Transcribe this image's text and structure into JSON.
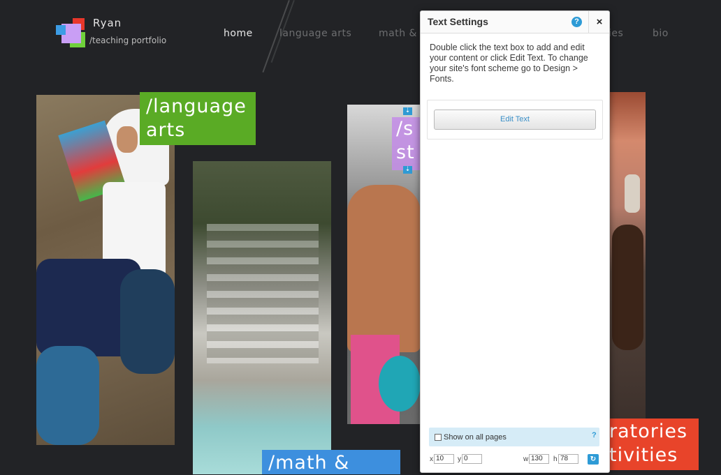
{
  "brand": {
    "name": "Ryan",
    "subtitle": "/teaching portfolio",
    "logo_colors": [
      "#e8372b",
      "#c99ef5",
      "#6fd03b",
      "#3c9ce4"
    ]
  },
  "nav": {
    "items": [
      {
        "label": "home",
        "active": true
      },
      {
        "label": "language arts",
        "active": false
      },
      {
        "label": "math & s",
        "active": false
      },
      {
        "label": "ies",
        "active": false
      },
      {
        "label": "bio",
        "active": false
      }
    ]
  },
  "gallery": {
    "language_label_1": "/language",
    "language_label_2": "arts",
    "math_label": "/math &",
    "science_label_1": "/s",
    "science_label_2": "st",
    "labs_label_1": "ratories",
    "labs_label_2": "tivities",
    "colors": {
      "language": "#5aab25",
      "math": "#3d8fde",
      "science": "#c38ce8",
      "labs": "#e8442a"
    }
  },
  "panel": {
    "title": "Text Settings",
    "help_icon": "?",
    "close_icon": "×",
    "description": "Double click the text box to add and edit your content or click Edit Text. To change your site's font scheme go to Design > Fonts.",
    "edit_button": "Edit Text",
    "show_all_pages": "Show on all pages",
    "show_help": "?",
    "x_label": "x",
    "x_value": "10",
    "y_label": "y",
    "y_value": "0",
    "w_label": "w",
    "w_value": "130",
    "h_label": "h",
    "h_value": "78"
  }
}
